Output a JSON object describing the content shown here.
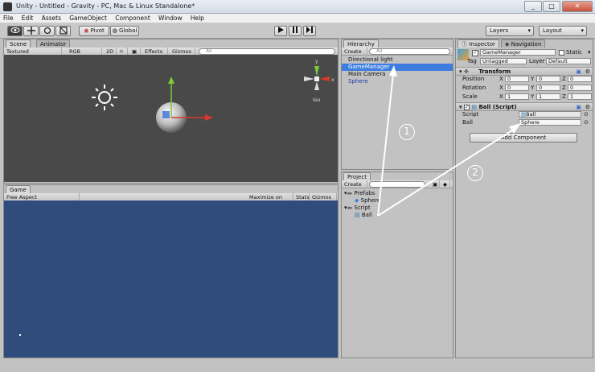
{
  "window": {
    "title": "Unity - Untitled - Gravity - PC, Mac & Linux Standalone*",
    "controls": [
      "_",
      "□",
      "✕"
    ]
  },
  "menu": [
    "File",
    "Edit",
    "Assets",
    "GameObject",
    "Component",
    "Window",
    "Help"
  ],
  "toolbar": {
    "pivot_label": "Pivot",
    "global_label": "Global",
    "layers_label": "Layers",
    "layout_label": "Layout"
  },
  "scene": {
    "tabs": [
      "Scene",
      "Animator"
    ],
    "subbar": [
      "Textured",
      "RGB",
      "2D",
      "Effects",
      "Gizmos"
    ],
    "search_placeholder": "All",
    "gizmo_label": "Iso",
    "gizmo_axes": [
      "y",
      "x"
    ]
  },
  "game": {
    "tab": "Game",
    "aspect": "Free Aspect",
    "options": [
      "Maximize on Play",
      "Stats",
      "Gizmos"
    ]
  },
  "hierarchy": {
    "tab": "Hierarchy",
    "create_label": "Create",
    "search_placeholder": "All",
    "items": [
      "Directional light",
      "GameManager",
      "Main Camera",
      "Sphere"
    ],
    "selected": "GameManager"
  },
  "project": {
    "tab": "Project",
    "create_label": "Create",
    "items": [
      "Prefabs",
      "Sphere",
      "Script",
      "Ball"
    ]
  },
  "inspector": {
    "tabs": [
      "Inspector",
      "Navigation"
    ],
    "object_name": "GameManager",
    "static_label": "Static",
    "tag_label": "Tag",
    "tag_value": "Untagged",
    "layer_label": "Layer",
    "layer_value": "Default",
    "transform": {
      "title": "Transform",
      "rows": [
        {
          "label": "Position",
          "x": "0",
          "y": "0",
          "z": "0"
        },
        {
          "label": "Rotation",
          "x": "0",
          "y": "0",
          "z": "0"
        },
        {
          "label": "Scale",
          "x": "1",
          "y": "1",
          "z": "1"
        }
      ],
      "axis_labels": [
        "X",
        "Y",
        "Z"
      ]
    },
    "script_component": {
      "title": "Ball (Script)",
      "script_label": "Script",
      "script_value": "Ball",
      "ball_label": "Ball",
      "ball_value": "Sphere"
    },
    "add_component_label": "Add Component"
  },
  "annotations": [
    "1",
    "2"
  ],
  "colors": {
    "selection": "#3d7de0",
    "scene_bg": "#494949",
    "game_bg": "#2f4c7c"
  }
}
